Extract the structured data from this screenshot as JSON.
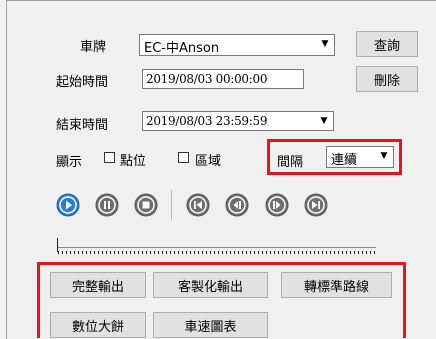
{
  "form": {
    "vehicle_label": "車牌",
    "vehicle_value": "EC-中Anson",
    "start_label": "起始時間",
    "start_value": "2019/08/03 00:00:00",
    "end_label": "結束時間",
    "end_value": "2019/08/03 23:59:59",
    "query_button": "查詢",
    "delete_button": "刪除"
  },
  "display": {
    "label": "顯示",
    "point_label": "點位",
    "point_checked": false,
    "area_label": "區域",
    "area_checked": false,
    "interval_label": "間隔",
    "interval_value": "連續"
  },
  "playback": {
    "buttons": [
      "play",
      "pause",
      "stop",
      "previous",
      "rewind",
      "fast-forward",
      "next"
    ],
    "position_percent": 0
  },
  "actions": {
    "row1": [
      "完整輸出",
      "客製化輸出",
      "轉標準路線"
    ],
    "row2": [
      "數位大餅",
      "車速圖表"
    ]
  },
  "colors": {
    "highlight": "#e8141b",
    "play_blue": "#2a7fd4",
    "button_gray": "#6e6e6e"
  }
}
